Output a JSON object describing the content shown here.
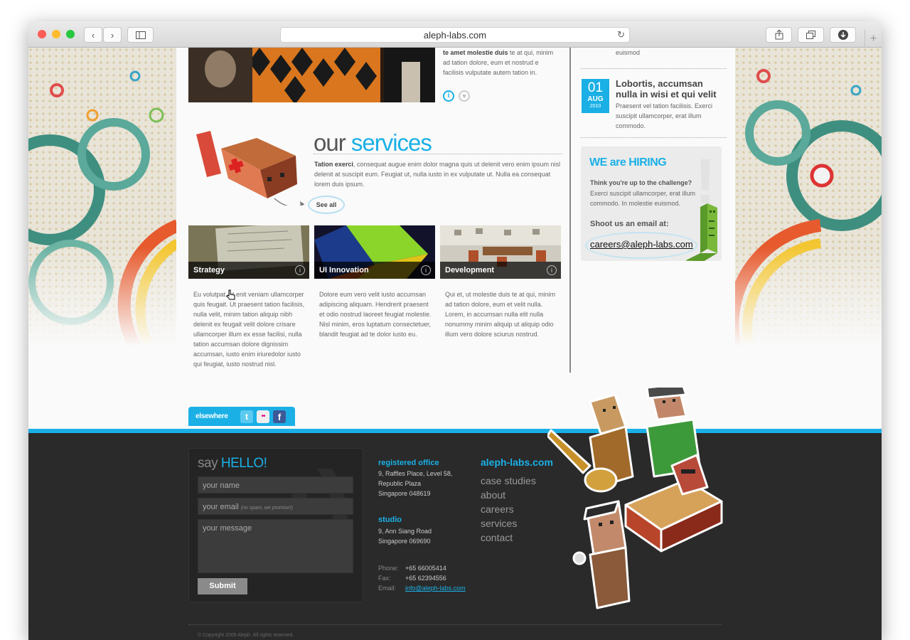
{
  "browser": {
    "url": "aleph-labs.com",
    "back_icon": "‹",
    "forward_icon": "›",
    "newtab_icon": "+"
  },
  "post": {
    "text_bold": "te amet molestie duis",
    "text": "te at qui, minim ad tation dolore, eum et nostrud e facilisis vulputate autem tation in."
  },
  "news": {
    "prev_tail": "euismod",
    "item": {
      "day": "01",
      "month": "AUG",
      "year": "2010",
      "title": "Lobortis, accumsan nulla in wisi et qui velit",
      "text": "Praesent vel tation facilisis. Exerci suscipit ullamcorper, erat illum commodo."
    }
  },
  "services": {
    "heading_plain": "our",
    "heading_accent": "services",
    "intro_bold": "Tation exerci",
    "intro": ", consequat augue enim dolor magna quis ut delenit vero enim ipsum nisl delenit at suscipit eum. Feugiat ut, nulla iusto in ex vulputate ut. Nulla ea consequat lorem duis ipsum.",
    "see_all": "See all",
    "tiles": [
      {
        "label": "Strategy",
        "desc": "Eu volutpat, ut enit veniam ullamcorper quis feugait. Ut praesent tation facilisis, nulla velit, minim tation aliquip nibh delenit ex feugait velit dolore crisare ullamcorper illum ex esse facilisi, nulla tation accumsan dolore dignissim accumsan, iusto enim iriuredolor iusto qui feugiat, iusto nostrud nisl."
      },
      {
        "label": "UI Innovation",
        "desc": "Dolore eum vero velit iusto accumsan adipiscing aliquam. Hendrerit praesent et odio nostrud laoreet feugiat molestie. Nisl minim, eros luptatum consectetuer, blandit feugiat ad te dolor iusto eu."
      },
      {
        "label": "Development",
        "desc": "Qui et, ut molestie duis te at qui, minim ad tation dolore, eum et velit nulla. Lorem, in accumsan nulla elit nulla nonummy minim aliquip ut aliquip odio illum vero dolore sciurus nostrud."
      }
    ]
  },
  "hiring": {
    "title": "WE are HIRING",
    "question": "Think you're up to the challenge?",
    "text": "Exerci suscipit ullamcorper, erat illum commodo. In molestie euismod.",
    "shoot": "Shoot us an email at:",
    "email": "careers@aleph-labs.com"
  },
  "elsewhere": {
    "label": "elsewhere",
    "twitter": "t",
    "flickr": "••",
    "facebook": "f"
  },
  "contact": {
    "say": "say",
    "hello": "HELLO!",
    "name_placeholder": "your name",
    "email_placeholder": "your email",
    "email_hint": "(no spam, we promise!)",
    "message_placeholder": "your message",
    "submit": "Submit"
  },
  "address": {
    "registered_title": "registered office",
    "registered_lines": [
      "9, Raffles Place, Level 58,",
      "Republic Plaza",
      "Singapore 048619"
    ],
    "studio_title": "studio",
    "studio_lines": [
      "9, Ann Siang Road",
      "Singapore 069690"
    ],
    "phone_label": "Phone:",
    "phone": "+65 66005414",
    "fax_label": "Fax:",
    "fax": "+65 62394556",
    "email_label": "Email:",
    "email": "info@aleph-labs.com"
  },
  "sitemap": {
    "title": "aleph-labs.com",
    "links": [
      "case studies",
      "about",
      "careers",
      "services",
      "contact"
    ]
  },
  "copyright": "© Copyright 2009 Aleph. All rights reserved.",
  "colors": {
    "accent": "#1ab0e6",
    "footer": "#2a2a2a"
  }
}
